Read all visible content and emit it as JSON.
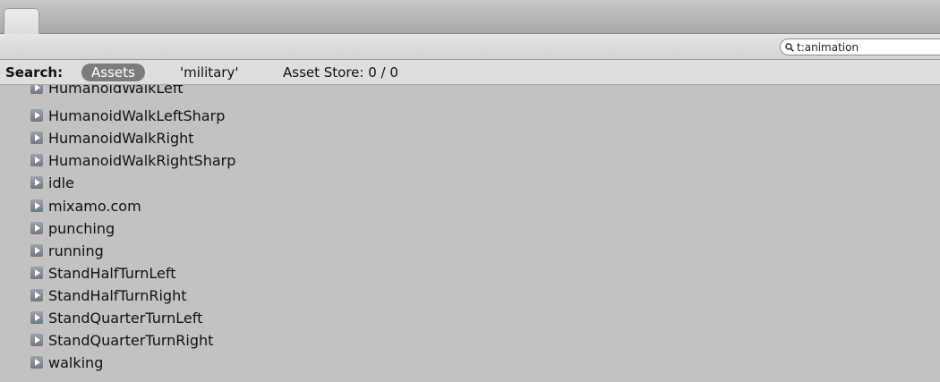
{
  "search_field": {
    "value": "t:animation"
  },
  "search_bar": {
    "label": "Search:",
    "scope": "Assets",
    "term": "'military'",
    "asset_store": "Asset Store: 0 / 0"
  },
  "items": [
    {
      "label": "HumanoidWalkLeft",
      "icon": "animation-clip-icon"
    },
    {
      "label": "HumanoidWalkLeftSharp",
      "icon": "animation-clip-icon"
    },
    {
      "label": "HumanoidWalkRight",
      "icon": "animation-clip-icon"
    },
    {
      "label": "HumanoidWalkRightSharp",
      "icon": "animation-clip-icon"
    },
    {
      "label": "idle",
      "icon": "animation-clip-icon"
    },
    {
      "label": "mixamo.com",
      "icon": "animation-clip-icon"
    },
    {
      "label": "punching",
      "icon": "animation-clip-icon"
    },
    {
      "label": "running",
      "icon": "animation-clip-icon"
    },
    {
      "label": "StandHalfTurnLeft",
      "icon": "animation-clip-icon"
    },
    {
      "label": "StandHalfTurnRight",
      "icon": "animation-clip-icon"
    },
    {
      "label": "StandQuarterTurnLeft",
      "icon": "animation-clip-icon"
    },
    {
      "label": "StandQuarterTurnRight",
      "icon": "animation-clip-icon"
    },
    {
      "label": "walking",
      "icon": "animation-clip-icon"
    }
  ]
}
